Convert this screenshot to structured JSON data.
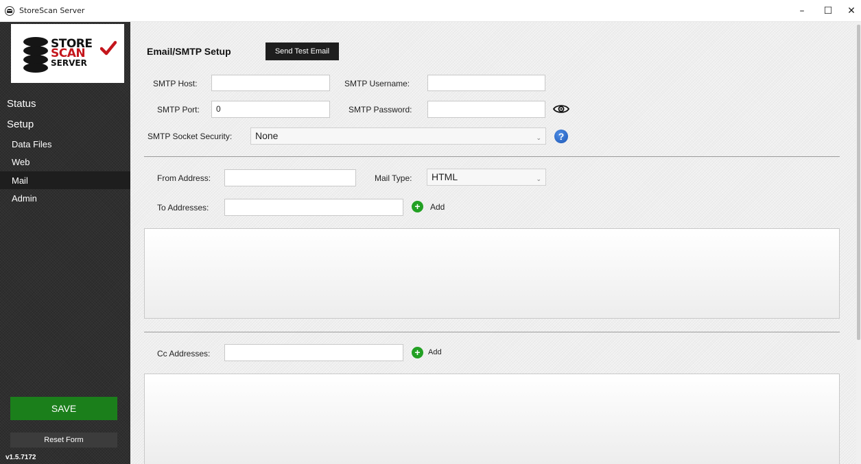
{
  "window": {
    "title": "StoreScan Server",
    "controls": {
      "minimize": "–",
      "maximize": "☐",
      "close": "✕"
    }
  },
  "logo": {
    "store": "STORE",
    "scan": "SCAN",
    "server": "SERVER",
    "brand_red": "#c4161c"
  },
  "sidebar": {
    "status": "Status",
    "setup": "Setup",
    "items": [
      {
        "label": "Data Files",
        "active": false
      },
      {
        "label": "Web",
        "active": false
      },
      {
        "label": "Mail",
        "active": true
      },
      {
        "label": "Admin",
        "active": false
      }
    ],
    "save_label": "SAVE",
    "reset_label": "Reset Form",
    "version": "v1.5.7172",
    "save_color": "#1b7f1b"
  },
  "form": {
    "heading": "Email/SMTP Setup",
    "send_test_label": "Send Test Email",
    "smtp_host_label": "SMTP Host:",
    "smtp_host_value": "",
    "smtp_username_label": "SMTP Username:",
    "smtp_username_value": "",
    "smtp_port_label": "SMTP Port:",
    "smtp_port_value": "0",
    "smtp_password_label": "SMTP Password:",
    "smtp_password_value": "",
    "socket_security_label": "SMTP Socket Security:",
    "socket_security_value": "None",
    "help_glyph": "?",
    "from_address_label": "From Address:",
    "from_address_value": "",
    "mail_type_label": "Mail Type:",
    "mail_type_value": "HTML",
    "to_addresses_label": "To Addresses:",
    "to_addresses_value": "",
    "add_label": "Add",
    "cc_addresses_label": "Cc Addresses:",
    "cc_addresses_value": "",
    "add_glyph": "+"
  },
  "icons": {
    "app": "app-logo-icon",
    "eye": "eye-icon",
    "help": "help-icon",
    "add": "plus-circle-icon",
    "dropdown": "chevron-down-icon"
  }
}
